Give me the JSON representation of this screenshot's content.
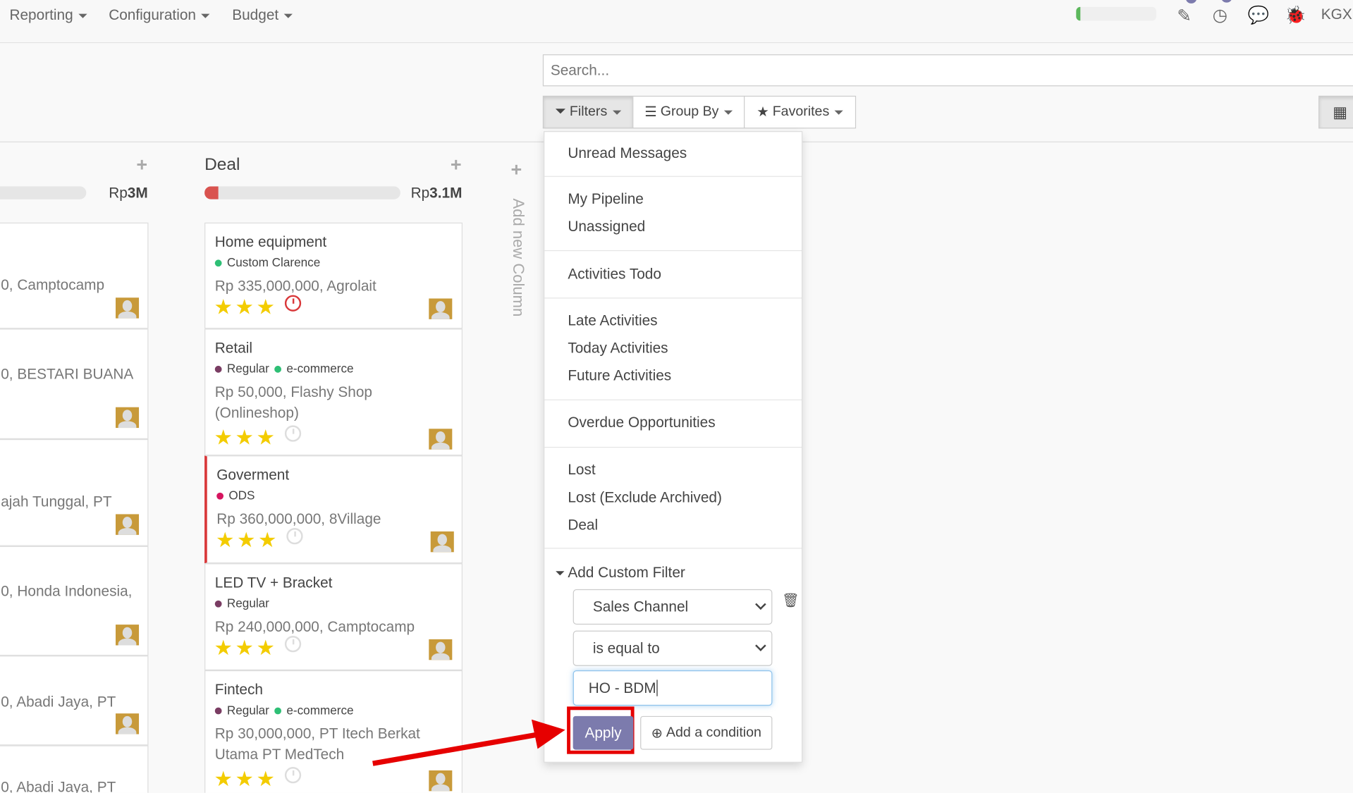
{
  "topbar": {
    "menus": [
      "Reporting",
      "Configuration",
      "Budget"
    ],
    "user": "KGX",
    "progress": 0.05,
    "icons": [
      "edit-icon",
      "clock-icon",
      "chat-icon",
      "bug-icon"
    ]
  },
  "search": {
    "placeholder": "Search..."
  },
  "toolbar": {
    "filters": "Filters",
    "group_by": "Group By",
    "favorites": "Favorites"
  },
  "filters_menu": {
    "items": [
      "Unread Messages",
      "My Pipeline",
      "Unassigned",
      "Activities Todo",
      "Late Activities",
      "Today Activities",
      "Future Activities",
      "Overdue Opportunities",
      "Lost",
      "Lost (Exclude Archived)",
      "Deal"
    ],
    "custom_filter_label": "Add Custom Filter",
    "field": "Sales Channel",
    "operator": "is equal to",
    "value": "HO - BDM",
    "apply": "Apply",
    "add_condition": "Add a condition"
  },
  "columns": {
    "left": {
      "total_prefix": "Rp",
      "total": "3M",
      "cards": [
        "0, Camptocamp",
        "0, BESTARI BUANA",
        "ajah Tunggal, PT",
        "0, Honda Indonesia,",
        "0, Abadi Jaya, PT",
        "0, Abadi Jaya, PT"
      ]
    },
    "deal": {
      "title": "Deal",
      "total_prefix": "Rp",
      "total": "3.1M",
      "progress": 0.07,
      "cards": [
        {
          "title": "Home equipment",
          "tags": [
            {
              "name": "Custom Clarence",
              "color": "#2ebf75"
            }
          ],
          "amount": "Rp 335,000,000, Agrolait",
          "stars": 3,
          "activity": "late"
        },
        {
          "title": "Retail",
          "tags": [
            {
              "name": "Regular",
              "color": "#7a3d63"
            },
            {
              "name": "e-commerce",
              "color": "#2ebf75"
            }
          ],
          "amount": "Rp 50,000, Flashy Shop (Onlineshop)",
          "stars": 3,
          "activity": "none"
        },
        {
          "title": "Goverment",
          "tags": [
            {
              "name": "ODS",
              "color": "#d6145f"
            }
          ],
          "amount": "Rp 360,000,000, 8Village",
          "stars": 3,
          "activity": "none"
        },
        {
          "title": "LED TV + Bracket",
          "tags": [
            {
              "name": "Regular",
              "color": "#7a3d63"
            }
          ],
          "amount": "Rp 240,000,000, Camptocamp",
          "stars": 3,
          "activity": "none"
        },
        {
          "title": "Fintech",
          "tags": [
            {
              "name": "Regular",
              "color": "#7a3d63"
            },
            {
              "name": "e-commerce",
              "color": "#2ebf75"
            }
          ],
          "amount": "Rp 30,000,000, PT Itech Berkat Utama PT MedTech",
          "stars": 3,
          "activity": "none"
        }
      ]
    },
    "add_new_column": "Add new Column"
  },
  "colors": {
    "accent": "#7c7bad",
    "highlight": "#e60000",
    "danger": "#d9383a"
  }
}
